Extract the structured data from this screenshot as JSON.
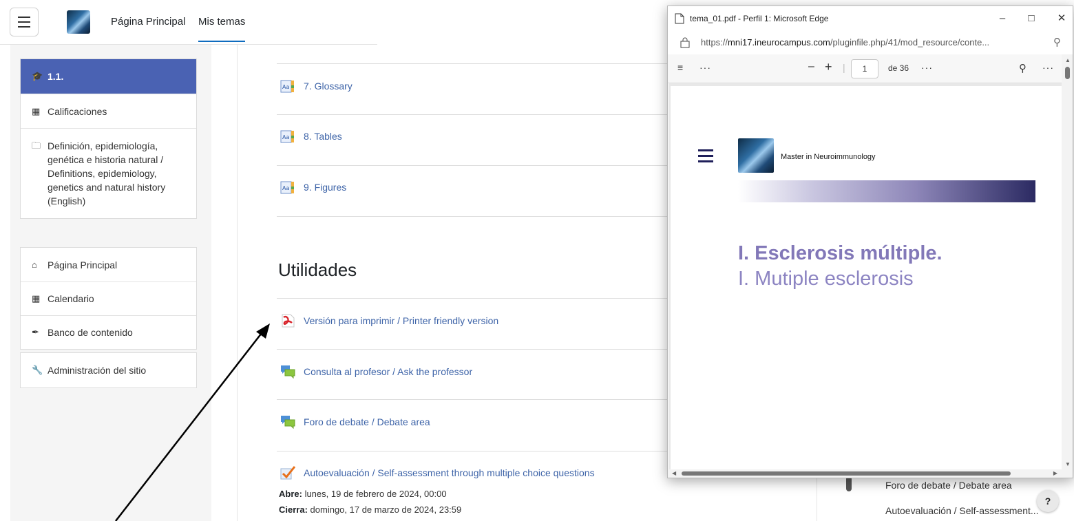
{
  "topnav": {
    "home": "Página Principal",
    "my_courses": "Mis temas"
  },
  "drawer": {
    "course_label": "1.1.",
    "grades": "Calificaciones",
    "section": "Definición, epidemiología, genética e historia natural / Definitions, epidemiology, genetics and natural history (English)",
    "home": "Página Principal",
    "calendar": "Calendario",
    "content_bank": "Banco de contenido",
    "site_admin": "Administración del sitio"
  },
  "main": {
    "activities_top": [
      {
        "label": "7. Glossary",
        "icon": "glossary-icon"
      },
      {
        "label": "8. Tables",
        "icon": "glossary-icon"
      },
      {
        "label": "9. Figures",
        "icon": "glossary-icon"
      }
    ],
    "section_title": "Utilidades",
    "activities": [
      {
        "label": "Versión para imprimir / Printer friendly version",
        "icon": "pdf-icon"
      },
      {
        "label": "Consulta al profesor / Ask the professor",
        "icon": "forum-icon"
      },
      {
        "label": "Foro de debate / Debate area",
        "icon": "forum-icon"
      },
      {
        "label": "Autoevaluación / Self-assessment through multiple choice questions",
        "icon": "quiz-icon"
      }
    ],
    "opens_label": "Abre:",
    "opens_value": " lunes, 19 de febrero de 2024, 00:00",
    "closes_label": "Cierra:",
    "closes_value": " domingo, 17 de marzo de 2024, 23:59"
  },
  "right_block": {
    "item1": "Foro de debate / Debate area",
    "item2": "Autoevaluación / Self-assessment...",
    "help": "?"
  },
  "edge": {
    "title": "tema_01.pdf - Perfil 1: Microsoft Edge",
    "url_prefix": "https://",
    "url_host": "mni17.ineurocampus.com",
    "url_rest": "/pluginfile.php/41/mod_resource/conte...",
    "page_number": "1",
    "page_total": "de 36",
    "pdf": {
      "brand": "Master in Neuroimmunology",
      "title": "I. Esclerosis múltiple.",
      "subtitle": "I. Mutiple esclerosis"
    }
  },
  "colors": {
    "drawer_head": "#4a62b3",
    "link": "#3e64a8",
    "pdf_title": "#8278b8"
  }
}
